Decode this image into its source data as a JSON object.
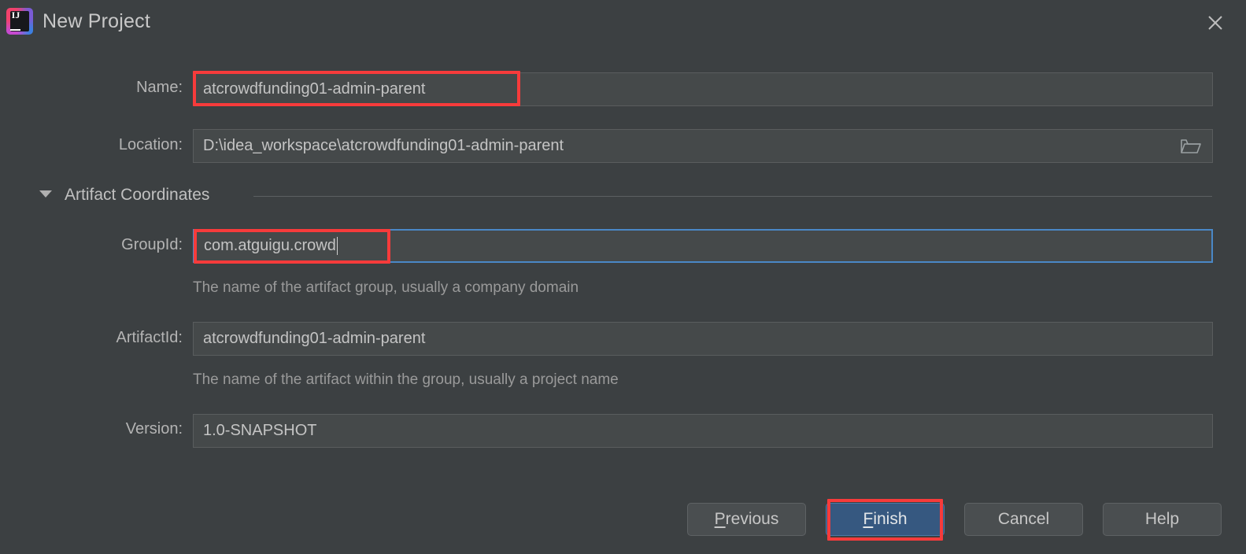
{
  "window": {
    "title": "New Project",
    "logo_icon": "intellij-idea-logo",
    "logo_text": "IJ",
    "close_icon": "close-icon"
  },
  "form": {
    "name": {
      "label": "Name:",
      "value": "atcrowdfunding01-admin-parent"
    },
    "location": {
      "label": "Location:",
      "value": "D:\\idea_workspace\\atcrowdfunding01-admin-parent",
      "browse_icon": "folder-icon"
    },
    "section": {
      "label": "Artifact Coordinates",
      "expanded": true,
      "toggle_icon": "chevron-down-icon"
    },
    "group_id": {
      "label": "GroupId:",
      "value": "com.atguigu.crowd",
      "hint": "The name of the artifact group, usually a company domain",
      "focused": true
    },
    "artifact_id": {
      "label": "ArtifactId:",
      "value": "atcrowdfunding01-admin-parent",
      "hint": "The name of the artifact within the group, usually a project name"
    },
    "version": {
      "label": "Version:",
      "value": "1.0-SNAPSHOT"
    }
  },
  "buttons": {
    "previous": {
      "label": "Previous",
      "mnemonic": "P"
    },
    "finish": {
      "label": "Finish",
      "mnemonic": "F",
      "default": true
    },
    "cancel": {
      "label": "Cancel"
    },
    "help": {
      "label": "Help"
    }
  },
  "colors": {
    "dialog_background": "#3c4042",
    "field_background": "#45494a",
    "focus_border": "#4a88c7",
    "primary_button": "#365880",
    "annotation": "#f73b3b"
  }
}
